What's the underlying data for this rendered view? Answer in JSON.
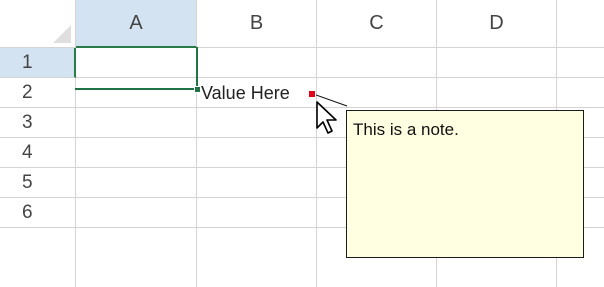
{
  "columns": [
    "A",
    "B",
    "C",
    "D"
  ],
  "rows": [
    "1",
    "2",
    "3",
    "4",
    "5",
    "6"
  ],
  "active_cell": "A1",
  "cells": {
    "B2": "Value Here"
  },
  "note": {
    "text": "This is a note.",
    "anchor_cell": "B2",
    "background": "#ffffe1",
    "indicator_color": "#e0001b"
  },
  "icons": {
    "select_all": "select-all-triangle",
    "cursor": "mouse-pointer"
  },
  "colors": {
    "selection": "#217346",
    "header_highlight": "#d3e3f1",
    "gridline": "#d4d4d4"
  }
}
